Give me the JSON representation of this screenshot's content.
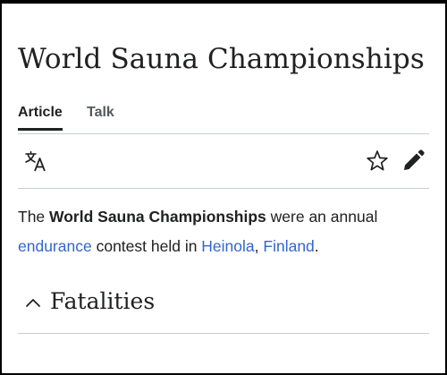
{
  "page": {
    "title": "World Sauna Championships"
  },
  "tabs": [
    {
      "label": "Article",
      "active": true
    },
    {
      "label": "Talk",
      "active": false
    }
  ],
  "toolbar": {
    "language_icon": "translate-icon",
    "watch_icon": "star-icon",
    "edit_icon": "pencil-icon"
  },
  "article": {
    "intro_pre": "The ",
    "intro_bold": "World Sauna Championships",
    "intro_mid": " were an annual ",
    "link_endurance": "endurance",
    "intro_mid2": " contest held in ",
    "link_heinola": "Heinola",
    "comma": ", ",
    "link_finland": "Finland",
    "period": "."
  },
  "section": {
    "title": "Fatalities",
    "expanded": true
  },
  "colors": {
    "text": "#202122",
    "link": "#3366cc",
    "divider": "#c8ccd1"
  }
}
